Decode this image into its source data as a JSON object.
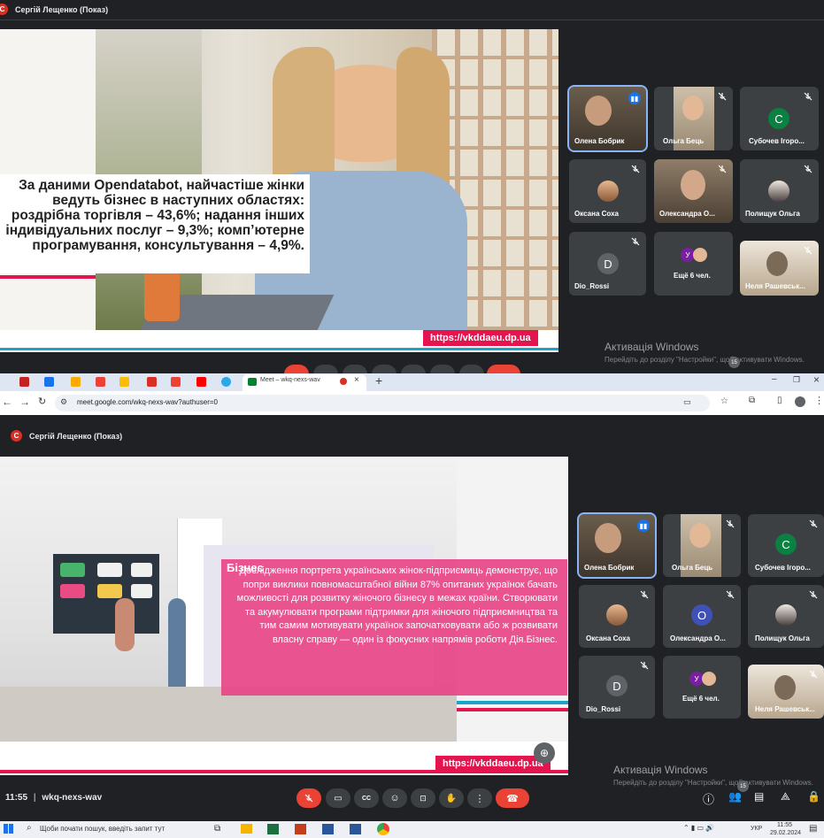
{
  "top_meet": {
    "presenter": "Сергій Лещенко (Показ)",
    "presenter_initial": "С",
    "slide_text": "За даними Opendatabot, найчастіше жінки ведуть бізнес в наступних областях: роздрібна торгівля – 43,6%; надання інших індивідуальних послуг – 9,3%; комп’ютерне програмування, консультування – 4,9%.",
    "slide_url": "https://vkddaeu.dp.ua",
    "participants": [
      {
        "name": "Олена Бобрик",
        "type": "video",
        "speaking": true
      },
      {
        "name": "Ольга Бець",
        "type": "video"
      },
      {
        "name": "Субочев Ігоро...",
        "type": "avatar",
        "initial": "С",
        "color": "#0b8043"
      },
      {
        "name": "Оксана Соха",
        "type": "photo"
      },
      {
        "name": "Олександра О...",
        "type": "video"
      },
      {
        "name": "Полищук Ольга",
        "type": "photo"
      },
      {
        "name": "Dio_Rossi",
        "type": "avatar",
        "initial": "D",
        "color": "#5f6368"
      },
      {
        "name": "Ещё 6 чел.",
        "type": "more",
        "initial": "У"
      },
      {
        "name": "Неля Рашевськ...",
        "type": "video"
      }
    ],
    "participant_count": "15",
    "watermark_title": "Активація Windows",
    "watermark_sub": "Перейдіть до розділу \"Настройки\", щоб активувати Windows."
  },
  "browser": {
    "active_tab_title": "Meet – wkq-nexs-wav",
    "url": "meet.google.com/wkq-nexs-wav?authuser=0"
  },
  "bottom_meet": {
    "presenter": "Сергій Лещенко (Показ)",
    "presenter_initial": "С",
    "slide_brand": "Бізнес",
    "slide_text": "Дослідження портрета українських жінок-підприємиць демонструє, що попри виклики повномасштабної війни 87% опитаних українок бачать можливості для розвитку жіночого бізнесу в межах країни. Створювати та акумулювати програми підтримки для жіночого підприємництва та тим самим мотивувати українок започатковувати або ж розвивати власну справу — один із фокусних напрямів роботи Дія.Бізнес.",
    "slide_url": "https://vkddaeu.dp.ua",
    "participants": [
      {
        "name": "Олена Бобрик",
        "type": "video",
        "speaking": true
      },
      {
        "name": "Ольга Бець",
        "type": "video"
      },
      {
        "name": "Субочев Ігоро...",
        "type": "avatar",
        "initial": "С",
        "color": "#0b8043"
      },
      {
        "name": "Оксана Соха",
        "type": "photo"
      },
      {
        "name": "Олександра О...",
        "type": "avatar",
        "initial": "О",
        "color": "#3f51b5"
      },
      {
        "name": "Полищук Ольга",
        "type": "photo"
      },
      {
        "name": "Dio_Rossi",
        "type": "avatar",
        "initial": "D",
        "color": "#5f6368"
      },
      {
        "name": "Ещё 6 чел.",
        "type": "more",
        "initial": "У"
      },
      {
        "name": "Неля Рашевськ...",
        "type": "video"
      }
    ],
    "time": "11:55",
    "meeting_code": "wkq-nexs-wav",
    "participant_count": "15",
    "watermark_title": "Активація Windows",
    "watermark_sub": "Перейдіть до розділу \"Настройки\", щоб активувати Windows."
  },
  "taskbar": {
    "search_placeholder": "Щоби почати пошук, введіть запит тут",
    "lang": "УКР",
    "time": "11:55",
    "date": "29.02.2024"
  }
}
